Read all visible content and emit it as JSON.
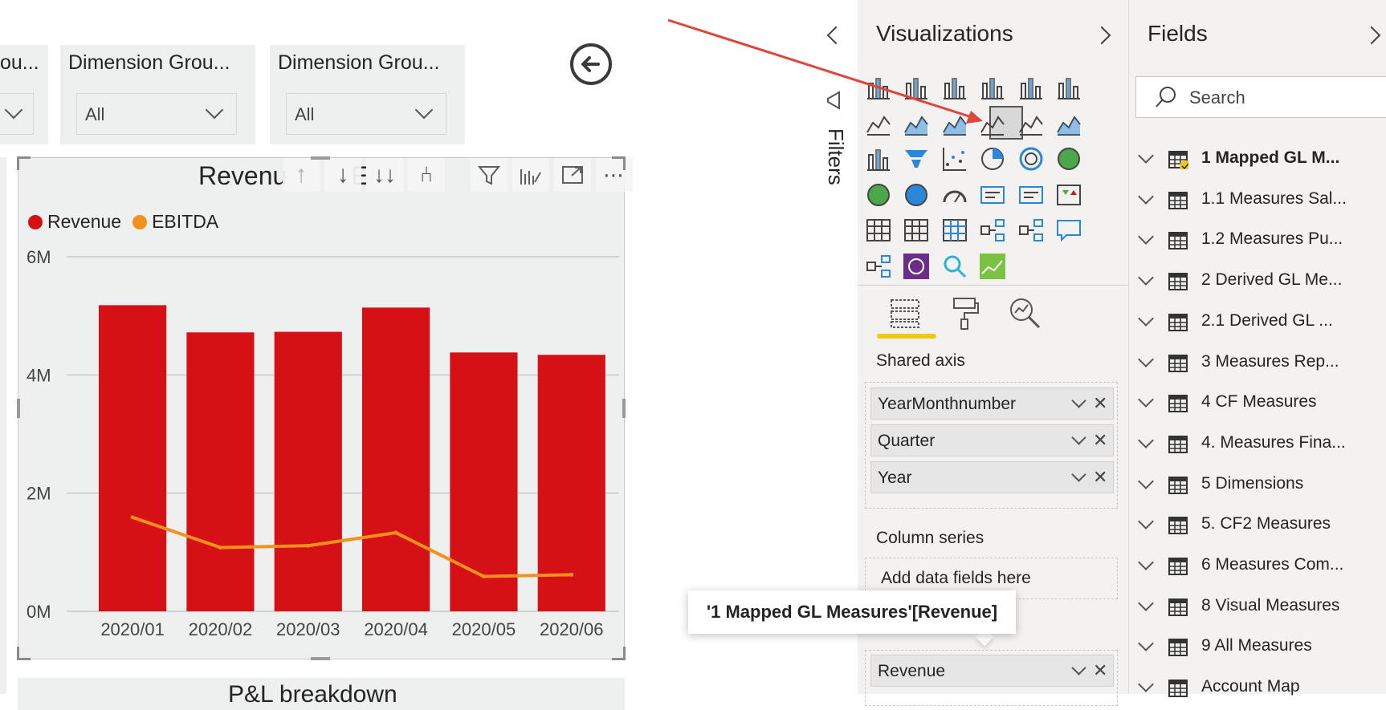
{
  "slicers": [
    {
      "title": "ou...",
      "value": ""
    },
    {
      "title": "Dimension Grou...",
      "value": "All"
    },
    {
      "title": "Dimension Grou...",
      "value": "All"
    }
  ],
  "chart_card": {
    "title": "Revenu",
    "title_tail": "E",
    "toolbar": {
      "sort_up": "↑",
      "sort_down": "↓",
      "drill_down_all": "↓↓",
      "expand_hierarchy": "⑃"
    },
    "colors": {
      "revenue": "#d51115",
      "ebitda": "#f2911b",
      "grid": "#c8c8c8",
      "axis_text": "#444444"
    }
  },
  "chart_data": {
    "type": "bar",
    "categories": [
      "2020/01",
      "2020/02",
      "2020/03",
      "2020/04",
      "2020/05",
      "2020/06"
    ],
    "series": [
      {
        "name": "Revenue",
        "type": "bar",
        "values": [
          5.18,
          4.72,
          4.73,
          5.14,
          4.38,
          4.34
        ]
      },
      {
        "name": "EBITDA",
        "type": "line",
        "values": [
          1.59,
          1.08,
          1.11,
          1.33,
          0.59,
          0.62
        ]
      }
    ],
    "yticks": [
      "0M",
      "2M",
      "4M",
      "6M"
    ],
    "ylim": [
      0,
      6
    ],
    "legend_position": "top-left",
    "grid": true
  },
  "breakdown": {
    "title": "P&L breakdown"
  },
  "tooltip": {
    "text": "'1 Mapped GL Measures'[Revenue]"
  },
  "filters_pane": {
    "label": "Filters"
  },
  "visualizations_pane": {
    "title": "Visualizations",
    "shared_axis_label": "Shared axis",
    "shared_axis_fields": [
      "YearMonthnumber",
      "Quarter",
      "Year"
    ],
    "column_series_label": "Column series",
    "column_series_placeholder": "Add data fields here",
    "column_values_fields": [
      "Revenue"
    ]
  },
  "fields_pane": {
    "title": "Fields",
    "search_placeholder": "Search",
    "tables": [
      {
        "name": "1 Mapped GL M...",
        "bold": true
      },
      {
        "name": "1.1 Measures Sal...",
        "bold": false
      },
      {
        "name": "1.2 Measures Pu...",
        "bold": false
      },
      {
        "name": "2 Derived GL Me...",
        "bold": false
      },
      {
        "name": "2.1 Derived GL ...",
        "bold": false
      },
      {
        "name": "3 Measures Rep...",
        "bold": false
      },
      {
        "name": "4 CF Measures",
        "bold": false
      },
      {
        "name": "4. Measures Fina...",
        "bold": false
      },
      {
        "name": "5 Dimensions",
        "bold": false
      },
      {
        "name": "5. CF2 Measures",
        "bold": false
      },
      {
        "name": "6 Measures Com...",
        "bold": false
      },
      {
        "name": "8 Visual Measures",
        "bold": false
      },
      {
        "name": "9 All Measures",
        "bold": false
      },
      {
        "name": "Account Map",
        "bold": false
      }
    ]
  }
}
